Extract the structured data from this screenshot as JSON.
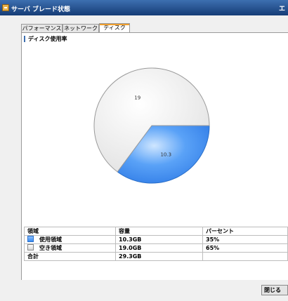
{
  "window": {
    "title": "サーバ ブレード状態",
    "right_glyph": "エ"
  },
  "tabs": [
    {
      "label": "パフォーマンス",
      "active": false
    },
    {
      "label": "ネットワーク",
      "active": false
    },
    {
      "label": "ディスク",
      "active": true
    }
  ],
  "section": {
    "title": "ディスク使用率"
  },
  "chart_data": {
    "type": "pie",
    "slices": [
      {
        "name": "使用領域",
        "value": 10.3,
        "color": "#3b8cf2"
      },
      {
        "name": "空き領域",
        "value": 19.0,
        "color": "#ededed"
      }
    ]
  },
  "table": {
    "headers": [
      "領域",
      "容量",
      "パーセント"
    ],
    "rows": [
      {
        "name": "使用領域",
        "capacity": "10.3GB",
        "percent": "35%",
        "swatch": "used"
      },
      {
        "name": "空き領域",
        "capacity": "19.0GB",
        "percent": "65%",
        "swatch": "free"
      },
      {
        "name": "合計",
        "capacity": "29.3GB",
        "percent": "",
        "swatch": ""
      }
    ]
  },
  "buttons": {
    "close_label": "閉じる"
  }
}
